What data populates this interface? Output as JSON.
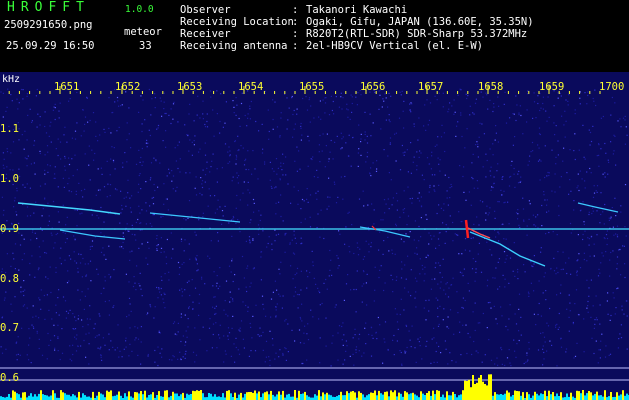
{
  "header": {
    "app_title": "HROFFT",
    "app_version": "1.0.0",
    "file_name": "2509291650.png",
    "datetime": "25.09.29 16:50",
    "meteor_label": "meteor",
    "meteor_count": "33"
  },
  "metadata": [
    {
      "label": "Observer",
      "value": "Takanori Kawachi"
    },
    {
      "label": "Receiving Location",
      "value": "Ogaki, Gifu, JAPAN (136.60E, 35.35N)"
    },
    {
      "label": "Receiver",
      "value": "R820T2(RTL-SDR) SDR-Sharp 53.372MHz"
    },
    {
      "label": "Receiving antenna",
      "value": "2el-HB9CV Vertical (el. E-W)"
    }
  ],
  "axis": {
    "unit": "kHz",
    "x_ticks": [
      "1651",
      "1652",
      "1653",
      "1654",
      "1655",
      "1656",
      "1657",
      "1658",
      "1659",
      "1700"
    ],
    "y_ticks": [
      "1.1",
      "1.0",
      "0.9",
      "0.8",
      "0.7",
      "0.6"
    ]
  },
  "colors": {
    "background": "#0a0a5c",
    "noise": "#2a2ad0",
    "signal": "#44e0ff",
    "burst": "#ff2020",
    "tick_text": "#ffff33",
    "level_bar": "#ffff00",
    "level_base": "#00e0ff"
  }
}
